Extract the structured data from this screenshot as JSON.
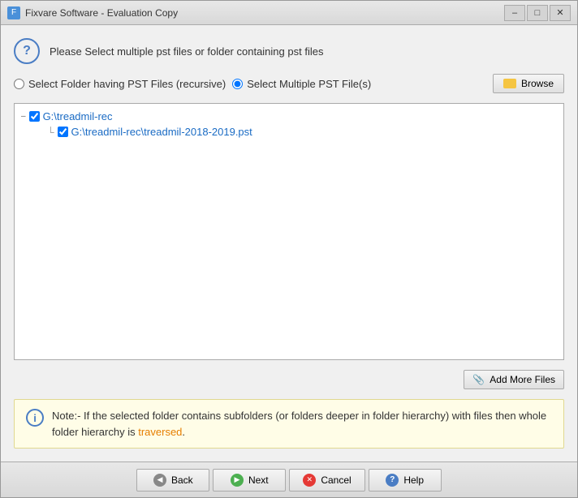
{
  "window": {
    "title": "Fixvare Software - Evaluation Copy",
    "icon_label": "F"
  },
  "header": {
    "text": "Please Select multiple pst files or folder containing pst files"
  },
  "radio_group": {
    "option1_label": "Select Folder having PST Files (recursive)",
    "option2_label": "Select Multiple PST File(s)",
    "option1_selected": false,
    "option2_selected": true
  },
  "browse_btn": {
    "label": "Browse"
  },
  "file_tree": {
    "root_path": "G:\\treadmil-rec",
    "child_path": "G:\\treadmil-rec\\treadmil-2018-2019.pst"
  },
  "add_files_btn": {
    "label": "Add More Files"
  },
  "note": {
    "text_before": "Note:- If the selected folder contains subfolders (or folders deeper in folder hierarchy) with files then whole folder hierarchy is ",
    "highlight": "traversed",
    "text_after": "."
  },
  "footer": {
    "back_label": "Back",
    "next_label": "Next",
    "cancel_label": "Cancel",
    "help_label": "Help"
  },
  "title_buttons": {
    "minimize": "–",
    "maximize": "□",
    "close": "✕"
  }
}
